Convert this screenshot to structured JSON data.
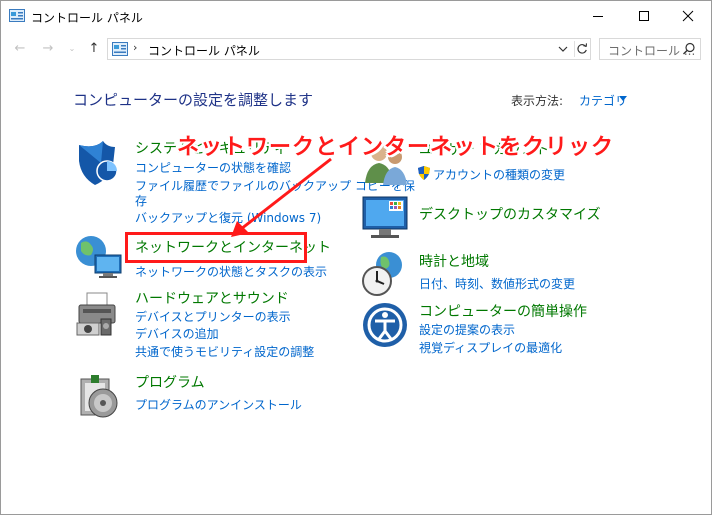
{
  "window": {
    "title": "コントロール パネル",
    "minimize_glyph": "—",
    "maximize_glyph": "☐",
    "close_glyph": "✕"
  },
  "nav": {
    "back_glyph": "←",
    "forward_glyph": "→",
    "recent_glyph": "⌄",
    "up_glyph": "↑",
    "breadcrumb_sep": "›",
    "address_text": "コントロール パネル",
    "search_placeholder": "コントロール ..."
  },
  "main": {
    "heading": "コンピューターの設定を調整します",
    "view_by_label": "表示方法:",
    "view_by_value": "カテゴリ"
  },
  "categories": {
    "system": {
      "title": "システムとセキュリティ",
      "links": [
        "コンピューターの状態を確認",
        "ファイル履歴でファイルのバックアップ コピーを保",
        "存",
        "バックアップと復元 (Windows 7)"
      ]
    },
    "network": {
      "title": "ネットワークとインターネット",
      "links": [
        "ネットワークの状態とタスクの表示"
      ]
    },
    "hardware": {
      "title": "ハードウェアとサウンド",
      "links": [
        "デバイスとプリンターの表示",
        "デバイスの追加",
        "共通で使うモビリティ設定の調整"
      ]
    },
    "programs": {
      "title": "プログラム",
      "links": [
        "プログラムのアンインストール"
      ]
    },
    "users": {
      "title": "ユーザー アカウント",
      "links": [
        "アカウントの種類の変更"
      ]
    },
    "appearance": {
      "title": "デスクトップのカスタマイズ"
    },
    "clock": {
      "title": "時計と地域",
      "links": [
        "日付、時刻、数値形式の変更"
      ]
    },
    "ease": {
      "title": "コンピューターの簡単操作",
      "links": [
        "設定の提案の表示",
        "視覚ディスプレイの最適化"
      ]
    }
  },
  "annotation": {
    "text": "ネットワークとインターネットをクリック",
    "color": "#ff1a1a"
  },
  "icons": [
    "control-panel-icon",
    "shield-icon",
    "network-globe-icon",
    "printer-icon",
    "programs-disc-icon",
    "users-icon",
    "uac-shield-icon",
    "desktop-monitor-icon",
    "clock-globe-icon",
    "ease-of-access-icon",
    "search-icon",
    "refresh-icon",
    "chevron-down-icon"
  ]
}
